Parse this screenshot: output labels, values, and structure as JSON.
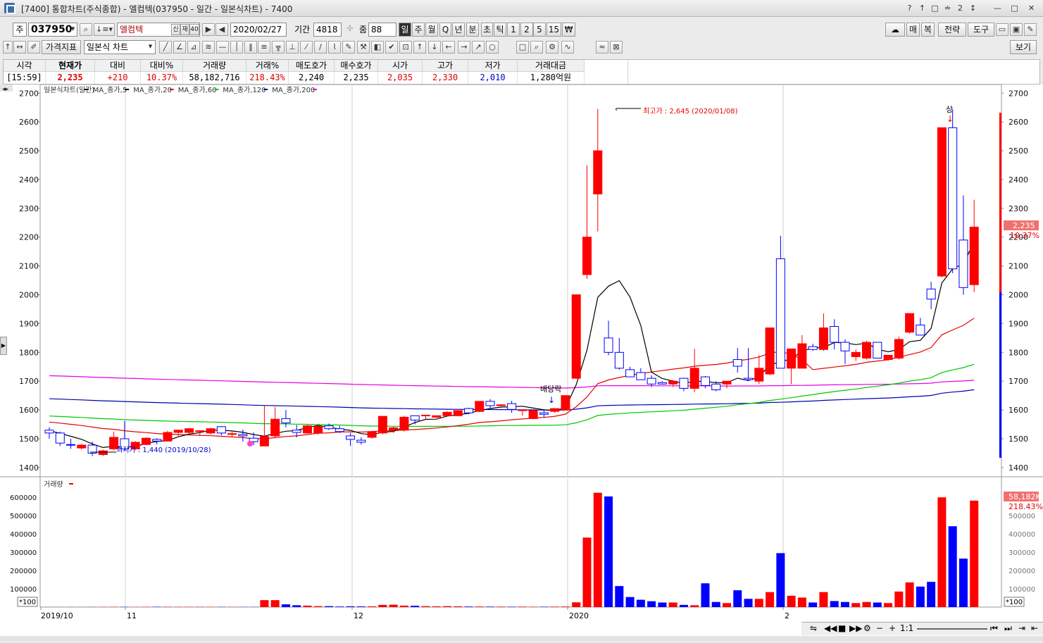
{
  "window": {
    "title": "[7400] 통합차트(주식종합) - 엘컴텍(037950 - 일간 - 일본식차트) - 7400",
    "title_buttons": [
      "?",
      "↑",
      "□",
      "≐",
      "2",
      "↕",
      "—",
      "□",
      "✕"
    ]
  },
  "toolbar1": {
    "market": "주",
    "code": "037950",
    "name": "엘컴텍",
    "sub_buttons": [
      "신",
      "재",
      "40"
    ],
    "date": "2020/02/27",
    "period_label": "기간",
    "period": "4818",
    "zoom_label": "줌",
    "zoom": "88",
    "periods": [
      "일",
      "주",
      "월",
      "Q",
      "년",
      "분",
      "초",
      "틱",
      "1",
      "2",
      "5",
      "15",
      "₩"
    ],
    "right_buttons": [
      "☁",
      "매",
      "복",
      "전략",
      "도구"
    ]
  },
  "toolbar2": {
    "indicator_label": "가격지표",
    "chart_type": "일본식 차트",
    "view_label": "보기"
  },
  "quote": {
    "headers": [
      "시각",
      "현재가",
      "대비",
      "대비%",
      "거래량",
      "거래%",
      "매도호가",
      "매수호가",
      "시가",
      "고가",
      "저가",
      "거래대금"
    ],
    "values": [
      "[15:59]",
      "2,235",
      "+210",
      "10.37%",
      "58,182,716",
      "218.43%",
      "2,240",
      "2,235",
      "2,035",
      "2,330",
      "2,010",
      "1,280억원"
    ],
    "colors": [
      "#000000",
      "#e00000",
      "#e00000",
      "#e00000",
      "#000000",
      "#e00000",
      "#000000",
      "#000000",
      "#e00000",
      "#e00000",
      "#0000cc",
      "#000000"
    ]
  },
  "price_legend": [
    "일본식차트(일간)",
    "MA_종가,5",
    "MA_종가,20",
    "MA_종가,60",
    "MA_종가,120",
    "MA_종가,200"
  ],
  "volume_legend": "거래량",
  "annotations": {
    "high": "최고가 : 2,645 (2020/01/08)",
    "low": "최저가 : 1,440 (2019/10/28)",
    "dividend": "배당락",
    "up": "상",
    "last_price": "2,235",
    "last_pct": "10.37%",
    "last_vol": "58,182K",
    "last_vol_pct": "218.43%",
    "vol_unit": "*100"
  },
  "colors": {
    "up": "#ff0000",
    "down": "#0000ff",
    "ma5": "#000000",
    "ma20": "#e60000",
    "ma60": "#00c800",
    "ma120": "#0000b4",
    "ma200": "#e600e6"
  },
  "chart_data": {
    "type": "candlestick",
    "price_axis": {
      "min": 1400,
      "max": 2700,
      "ticks": [
        2700,
        2600,
        2500,
        2400,
        2300,
        2200,
        2100,
        2000,
        1900,
        1800,
        1700,
        1600,
        1500,
        1400
      ]
    },
    "volume_axis": {
      "min": 0,
      "max": 600000,
      "ticks": [
        600000,
        500000,
        400000,
        300000,
        200000,
        100000
      ]
    },
    "x_labels": [
      "2019/10",
      "11",
      "12",
      "2020",
      "2"
    ],
    "candles": [
      {
        "o": 1530,
        "h": 1540,
        "l": 1500,
        "c": 1520
      },
      {
        "o": 1520,
        "h": 1525,
        "l": 1475,
        "c": 1485
      },
      {
        "o": 1480,
        "h": 1500,
        "l": 1465,
        "c": 1478
      },
      {
        "o": 1468,
        "h": 1482,
        "l": 1462,
        "c": 1478
      },
      {
        "o": 1478,
        "h": 1490,
        "l": 1440,
        "c": 1450
      },
      {
        "o": 1445,
        "h": 1462,
        "l": 1440,
        "c": 1458
      },
      {
        "o": 1465,
        "h": 1525,
        "l": 1460,
        "c": 1505
      },
      {
        "o": 1500,
        "h": 1562,
        "l": 1458,
        "c": 1465
      },
      {
        "o": 1465,
        "h": 1492,
        "l": 1460,
        "c": 1488
      },
      {
        "o": 1480,
        "h": 1505,
        "l": 1478,
        "c": 1502
      },
      {
        "o": 1498,
        "h": 1502,
        "l": 1480,
        "c": 1492
      },
      {
        "o": 1492,
        "h": 1528,
        "l": 1490,
        "c": 1522
      },
      {
        "o": 1522,
        "h": 1530,
        "l": 1510,
        "c": 1530
      },
      {
        "o": 1522,
        "h": 1538,
        "l": 1515,
        "c": 1535
      },
      {
        "o": 1525,
        "h": 1530,
        "l": 1510,
        "c": 1528
      },
      {
        "o": 1520,
        "h": 1538,
        "l": 1515,
        "c": 1535
      },
      {
        "o": 1542,
        "h": 1544,
        "l": 1512,
        "c": 1520
      },
      {
        "o": 1515,
        "h": 1525,
        "l": 1505,
        "c": 1518
      },
      {
        "o": 1515,
        "h": 1532,
        "l": 1490,
        "c": 1510
      },
      {
        "o": 1502,
        "h": 1522,
        "l": 1478,
        "c": 1490
      },
      {
        "o": 1475,
        "h": 1615,
        "l": 1475,
        "c": 1508
      },
      {
        "o": 1510,
        "h": 1610,
        "l": 1505,
        "c": 1568
      },
      {
        "o": 1570,
        "h": 1600,
        "l": 1540,
        "c": 1555
      },
      {
        "o": 1530,
        "h": 1548,
        "l": 1505,
        "c": 1522
      },
      {
        "o": 1520,
        "h": 1548,
        "l": 1518,
        "c": 1545
      },
      {
        "o": 1520,
        "h": 1543,
        "l": 1515,
        "c": 1543
      },
      {
        "o": 1545,
        "h": 1553,
        "l": 1530,
        "c": 1535
      },
      {
        "o": 1535,
        "h": 1545,
        "l": 1520,
        "c": 1525
      },
      {
        "o": 1510,
        "h": 1520,
        "l": 1475,
        "c": 1498
      },
      {
        "o": 1495,
        "h": 1505,
        "l": 1480,
        "c": 1488
      },
      {
        "o": 1505,
        "h": 1528,
        "l": 1500,
        "c": 1525
      },
      {
        "o": 1520,
        "h": 1577,
        "l": 1515,
        "c": 1578
      },
      {
        "o": 1530,
        "h": 1542,
        "l": 1520,
        "c": 1538
      },
      {
        "o": 1530,
        "h": 1580,
        "l": 1525,
        "c": 1575
      },
      {
        "o": 1580,
        "h": 1575,
        "l": 1550,
        "c": 1565
      },
      {
        "o": 1580,
        "h": 1582,
        "l": 1565,
        "c": 1582
      },
      {
        "o": 1575,
        "h": 1580,
        "l": 1572,
        "c": 1580
      },
      {
        "o": 1580,
        "h": 1595,
        "l": 1578,
        "c": 1592
      },
      {
        "o": 1580,
        "h": 1590,
        "l": 1578,
        "c": 1598
      },
      {
        "o": 1605,
        "h": 1608,
        "l": 1585,
        "c": 1590
      },
      {
        "o": 1595,
        "h": 1630,
        "l": 1592,
        "c": 1630
      },
      {
        "o": 1630,
        "h": 1638,
        "l": 1605,
        "c": 1615
      },
      {
        "o": 1615,
        "h": 1620,
        "l": 1610,
        "c": 1618
      },
      {
        "o": 1622,
        "h": 1632,
        "l": 1590,
        "c": 1602
      },
      {
        "o": 1600,
        "h": 1602,
        "l": 1580,
        "c": 1600
      },
      {
        "o": 1570,
        "h": 1598,
        "l": 1568,
        "c": 1598
      },
      {
        "o": 1590,
        "h": 1600,
        "l": 1575,
        "c": 1585
      },
      {
        "o": 1595,
        "h": 1605,
        "l": 1590,
        "c": 1605
      },
      {
        "o": 1600,
        "h": 1650,
        "l": 1598,
        "c": 1650
      },
      {
        "o": 1710,
        "h": 2000,
        "l": 1708,
        "c": 2000
      },
      {
        "o": 2070,
        "h": 2450,
        "l": 2055,
        "c": 2200
      },
      {
        "o": 2350,
        "h": 2645,
        "l": 2220,
        "c": 2500
      },
      {
        "o": 1850,
        "h": 1910,
        "l": 1790,
        "c": 1800
      },
      {
        "o": 1800,
        "h": 1850,
        "l": 1740,
        "c": 1745
      },
      {
        "o": 1740,
        "h": 1750,
        "l": 1715,
        "c": 1715
      },
      {
        "o": 1730,
        "h": 1745,
        "l": 1710,
        "c": 1705
      },
      {
        "o": 1710,
        "h": 1720,
        "l": 1680,
        "c": 1690
      },
      {
        "o": 1695,
        "h": 1700,
        "l": 1688,
        "c": 1690
      },
      {
        "o": 1690,
        "h": 1705,
        "l": 1680,
        "c": 1700
      },
      {
        "o": 1710,
        "h": 1712,
        "l": 1665,
        "c": 1675
      },
      {
        "o": 1675,
        "h": 1812,
        "l": 1662,
        "c": 1745
      },
      {
        "o": 1715,
        "h": 1718,
        "l": 1675,
        "c": 1685
      },
      {
        "o": 1690,
        "h": 1700,
        "l": 1665,
        "c": 1670
      },
      {
        "o": 1690,
        "h": 1700,
        "l": 1675,
        "c": 1700
      },
      {
        "o": 1775,
        "h": 1815,
        "l": 1730,
        "c": 1752
      },
      {
        "o": 1710,
        "h": 1815,
        "l": 1700,
        "c": 1705
      },
      {
        "o": 1700,
        "h": 1790,
        "l": 1690,
        "c": 1745
      },
      {
        "o": 1725,
        "h": 1885,
        "l": 1720,
        "c": 1885
      },
      {
        "o": 2125,
        "h": 2205,
        "l": 1745,
        "c": 1745
      },
      {
        "o": 1745,
        "h": 1810,
        "l": 1690,
        "c": 1812
      },
      {
        "o": 1745,
        "h": 1860,
        "l": 1745,
        "c": 1830
      },
      {
        "o": 1820,
        "h": 1830,
        "l": 1805,
        "c": 1810
      },
      {
        "o": 1810,
        "h": 1935,
        "l": 1805,
        "c": 1885
      },
      {
        "o": 1890,
        "h": 1915,
        "l": 1810,
        "c": 1835
      },
      {
        "o": 1835,
        "h": 1845,
        "l": 1760,
        "c": 1805
      },
      {
        "o": 1785,
        "h": 1810,
        "l": 1770,
        "c": 1800
      },
      {
        "o": 1780,
        "h": 1840,
        "l": 1775,
        "c": 1835
      },
      {
        "o": 1835,
        "h": 1835,
        "l": 1780,
        "c": 1780
      },
      {
        "o": 1775,
        "h": 1790,
        "l": 1770,
        "c": 1790
      },
      {
        "o": 1780,
        "h": 1855,
        "l": 1775,
        "c": 1845
      },
      {
        "o": 1870,
        "h": 1930,
        "l": 1865,
        "c": 1935
      },
      {
        "o": 1895,
        "h": 1920,
        "l": 1865,
        "c": 1860
      },
      {
        "o": 2020,
        "h": 2045,
        "l": 1950,
        "c": 1985
      },
      {
        "o": 2065,
        "h": 2545,
        "l": 2060,
        "c": 2580
      },
      {
        "o": 2580,
        "h": 2645,
        "l": 2075,
        "c": 2090
      },
      {
        "o": 2190,
        "h": 2345,
        "l": 2000,
        "c": 2025
      },
      {
        "o": 2035,
        "h": 2330,
        "l": 2010,
        "c": 2235
      }
    ],
    "volumes": [
      300,
      350,
      450,
      500,
      700,
      900,
      1400,
      1200,
      900,
      1500,
      1600,
      1700,
      1400,
      1500,
      1600,
      1300,
      1100,
      1000,
      900,
      800,
      38000,
      38000,
      15000,
      10000,
      8000,
      5000,
      5000,
      3000,
      4000,
      3500,
      4000,
      12000,
      13000,
      8000,
      7000,
      5000,
      4000,
      5000,
      4000,
      3000,
      3000,
      2500,
      2500,
      2000,
      2500,
      2000,
      2000,
      2500,
      3000,
      26000,
      380000,
      625000,
      605000,
      115000,
      55000,
      40000,
      32000,
      25000,
      25000,
      12000,
      10000,
      130000,
      28000,
      22000,
      92000,
      45000,
      45000,
      82000,
      295000,
      62000,
      52000,
      25000,
      82000,
      33000,
      28000,
      22000,
      28000,
      25000,
      22000,
      85000,
      135000,
      112000,
      138000,
      600000,
      442000,
      265000,
      582000
    ]
  }
}
